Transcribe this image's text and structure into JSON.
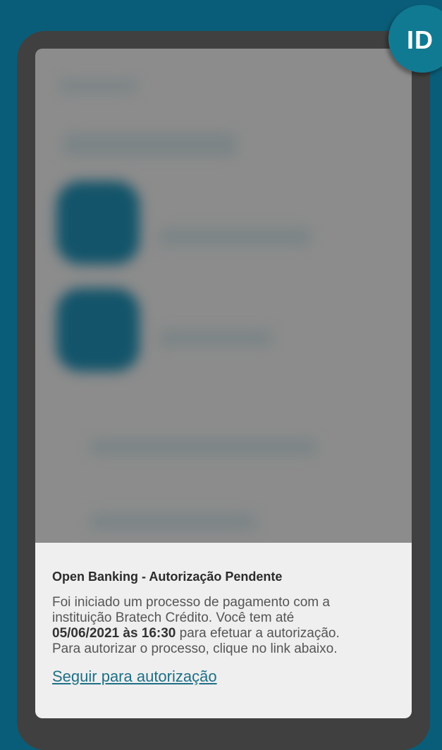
{
  "badge": {
    "label": "ID",
    "color": "#117a93"
  },
  "notification": {
    "title": "Open Banking - Autorização Pendente",
    "line1": "Foi iniciado um processo de pagamento com a",
    "line2": "instituição Bratech Crédito. Você tem até",
    "deadline": "05/06/2021 às 16:30",
    "line3_rest": " para efetuar a autorização.",
    "line4": "Para autorizar o processo, clique no link abaixo.",
    "link_label": "Seguir para autorização"
  },
  "colors": {
    "background": "#0a5d78",
    "link": "#1e6f86",
    "sheet": "#efefef"
  }
}
